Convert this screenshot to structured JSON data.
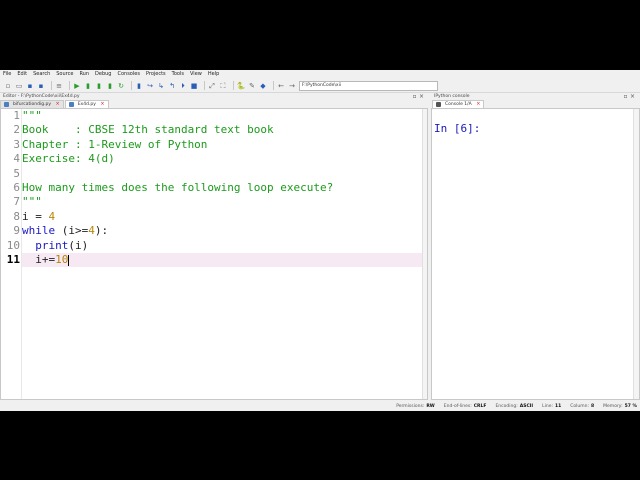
{
  "menu": [
    "File",
    "Edit",
    "Search",
    "Source",
    "Run",
    "Debug",
    "Consoles",
    "Projects",
    "Tools",
    "View",
    "Help"
  ],
  "toolbar": {
    "path": "F:\\PythonCode\\xii"
  },
  "editor": {
    "pane_title": "Editor - F:\\PythonCode\\xii\\Ex4d.py",
    "tabs": [
      {
        "label": "bifurcationdig.py",
        "active": false
      },
      {
        "label": "Ex4d.py",
        "active": true
      }
    ],
    "current_line": 11,
    "lines": [
      {
        "num": "1",
        "text": "\"\"\""
      },
      {
        "num": "2",
        "text": "Book    : CBSE 12th standard text book"
      },
      {
        "num": "3",
        "text": "Chapter : 1-Review of Python"
      },
      {
        "num": "4",
        "text": "Exercise: 4(d)"
      },
      {
        "num": "5",
        "text": ""
      },
      {
        "num": "6",
        "text": "How many times does the following loop execute?"
      },
      {
        "num": "7",
        "text": "\"\"\""
      },
      {
        "num": "8",
        "text": "i = 4"
      },
      {
        "num": "9",
        "text": "while (i>=4):"
      },
      {
        "num": "10",
        "text": "print(i)"
      },
      {
        "num": "11",
        "text": "i+=10"
      }
    ]
  },
  "console": {
    "pane_title": "IPython console",
    "tab_label": "Console 1/A",
    "prompt": "In [6]:"
  },
  "statusbar": {
    "permissions_label": "Permissions:",
    "permissions_value": "RW",
    "eol_label": "End-of-lines:",
    "eol_value": "CRLF",
    "encoding_label": "Encoding:",
    "encoding_value": "ASCII",
    "line_label": "Line:",
    "line_value": "11",
    "column_label": "Column:",
    "column_value": "8",
    "memory_label": "Memory:",
    "memory_value": "57 %"
  },
  "colors": {
    "docstring": "#1c9b1c",
    "keyword": "#1919c4",
    "number": "#b8860b",
    "current_line_bg": "#f7e9f4",
    "prompt": "#1a1ab8"
  }
}
